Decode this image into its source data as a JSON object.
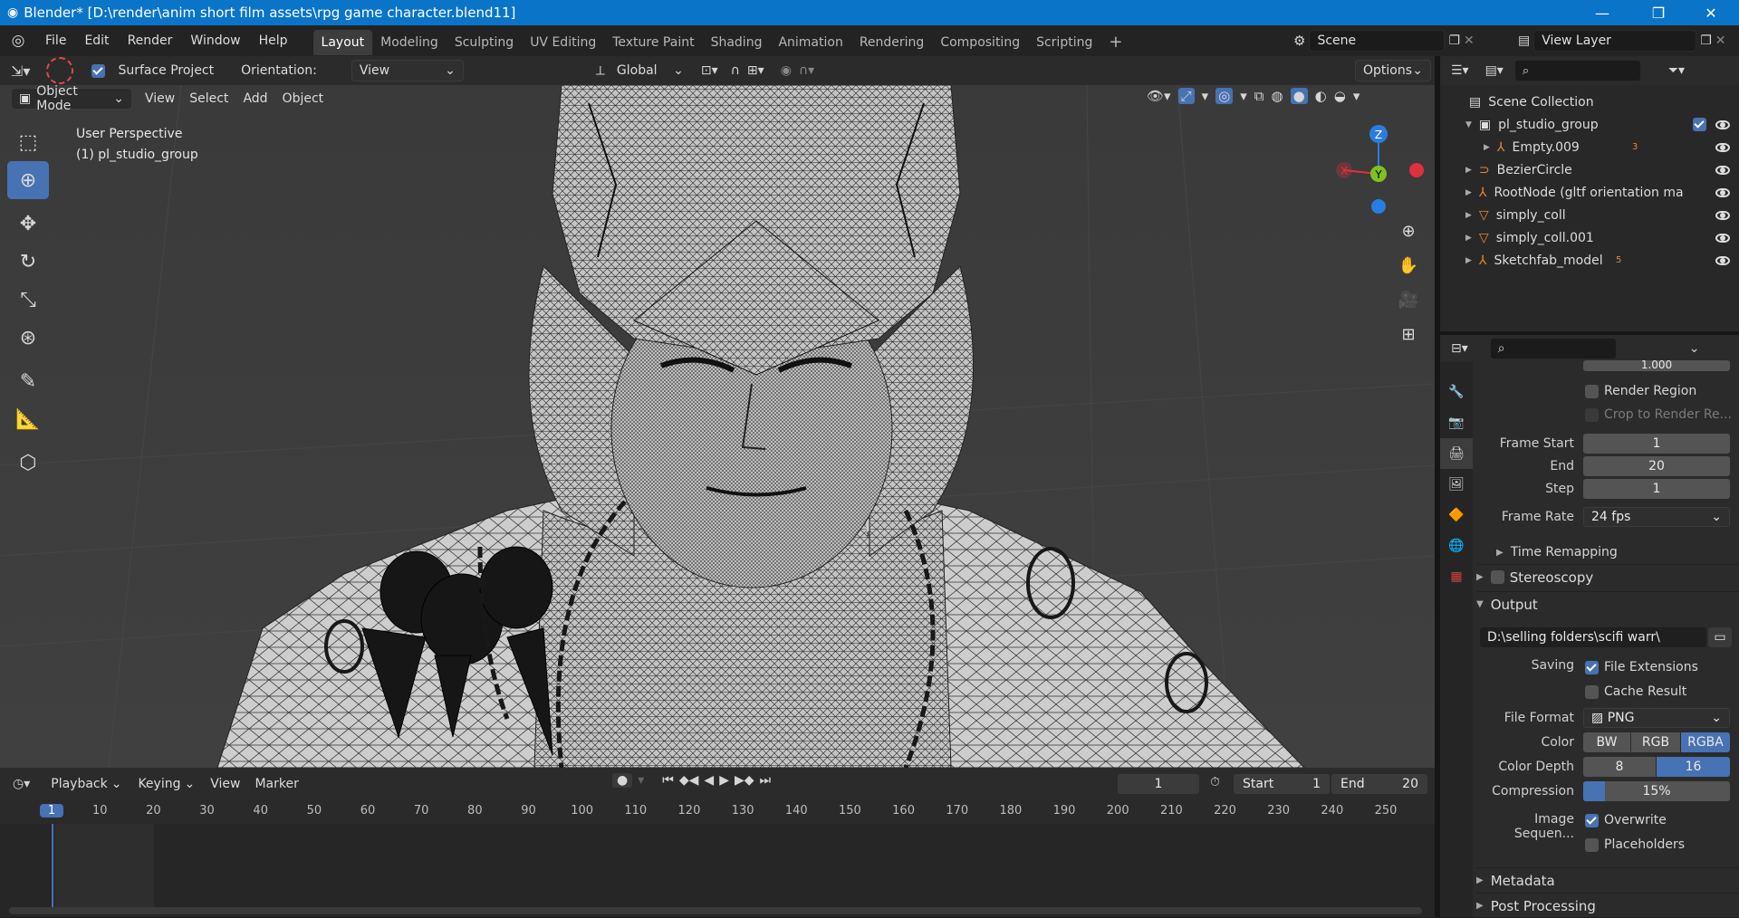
{
  "titlebar": {
    "title": "Blender* [D:\\render\\anim short film assets\\rpg game character.blend11]",
    "minimize": "—",
    "maximize": "❐",
    "close": "✕"
  },
  "menu": {
    "items": [
      "File",
      "Edit",
      "Render",
      "Window",
      "Help"
    ]
  },
  "workspaces": [
    "Layout",
    "Modeling",
    "Sculpting",
    "UV Editing",
    "Texture Paint",
    "Shading",
    "Animation",
    "Rendering",
    "Compositing",
    "Scripting"
  ],
  "active_workspace": "Layout",
  "scene": {
    "name": "Scene"
  },
  "view_layer": {
    "name": "View Layer"
  },
  "viewport_header": {
    "surface_project": "Surface Project",
    "orientation_label": "Orientation:",
    "orientation_value": "View",
    "transform_orientation": "Global",
    "options": "Options"
  },
  "viewport_header2": {
    "mode": "Object Mode",
    "menus": [
      "View",
      "Select",
      "Add",
      "Object"
    ]
  },
  "viewport_overlay": {
    "line1": "User Perspective",
    "line2": "(1) pl_studio_group"
  },
  "gizmo": {
    "x": "X",
    "y": "Y",
    "z": "Z"
  },
  "timeline": {
    "menus": [
      "Playback",
      "Keying",
      "View",
      "Marker"
    ],
    "current_frame": "1",
    "start_label": "Start",
    "start": "1",
    "end_label": "End",
    "end": "20",
    "ticks": [
      "1",
      "10",
      "20",
      "30",
      "40",
      "50",
      "60",
      "70",
      "80",
      "90",
      "100",
      "110",
      "120",
      "130",
      "140",
      "150",
      "160",
      "170",
      "180",
      "190",
      "200",
      "210",
      "220",
      "230",
      "240",
      "250"
    ]
  },
  "outliner": {
    "root": "Scene Collection",
    "items": [
      {
        "name": "pl_studio_group",
        "indent": 1,
        "icon": "collection-icon"
      },
      {
        "name": "Empty.009",
        "indent": 2,
        "icon": "empty-icon",
        "badge": "3"
      },
      {
        "name": "BezierCircle",
        "indent": 1,
        "icon": "curve-icon"
      },
      {
        "name": "RootNode (gltf orientation ma",
        "indent": 1,
        "icon": "empty-icon"
      },
      {
        "name": "simply_coll",
        "indent": 1,
        "icon": "mesh-icon"
      },
      {
        "name": "simply_coll.001",
        "indent": 1,
        "icon": "mesh-icon"
      },
      {
        "name": "Sketchfab_model",
        "indent": 1,
        "icon": "empty-icon",
        "badge": "5"
      }
    ]
  },
  "properties": {
    "partial_value": "1.000",
    "render_region": "Render Region",
    "crop": "Crop to Render Re...",
    "frame_start_label": "Frame Start",
    "frame_start": "1",
    "end_label": "End",
    "end": "20",
    "step_label": "Step",
    "step": "1",
    "frame_rate_label": "Frame Rate",
    "frame_rate": "24 fps",
    "time_remapping": "Time Remapping",
    "stereoscopy": "Stereoscopy",
    "output": "Output",
    "output_path": "D:\\selling folders\\scifi warr\\",
    "saving_label": "Saving",
    "file_extensions": "File Extensions",
    "cache_result": "Cache Result",
    "file_format_label": "File Format",
    "file_format": "PNG",
    "color_label": "Color",
    "color_options": [
      "BW",
      "RGB",
      "RGBA"
    ],
    "color_selected": "RGBA",
    "color_depth_label": "Color Depth",
    "depth_options": [
      "8",
      "16"
    ],
    "depth_selected": "16",
    "compression_label": "Compression",
    "compression": "15%",
    "compression_fraction": 0.15,
    "image_seq_label": "Image Sequen...",
    "overwrite": "Overwrite",
    "placeholders": "Placeholders",
    "metadata": "Metadata",
    "post_processing": "Post Processing"
  },
  "colors": {
    "accent": "#4772b3",
    "titlebar": "#0a74c9",
    "x_axis": "#e0303d",
    "y_axis": "#80c020",
    "z_axis": "#2a7de0"
  }
}
